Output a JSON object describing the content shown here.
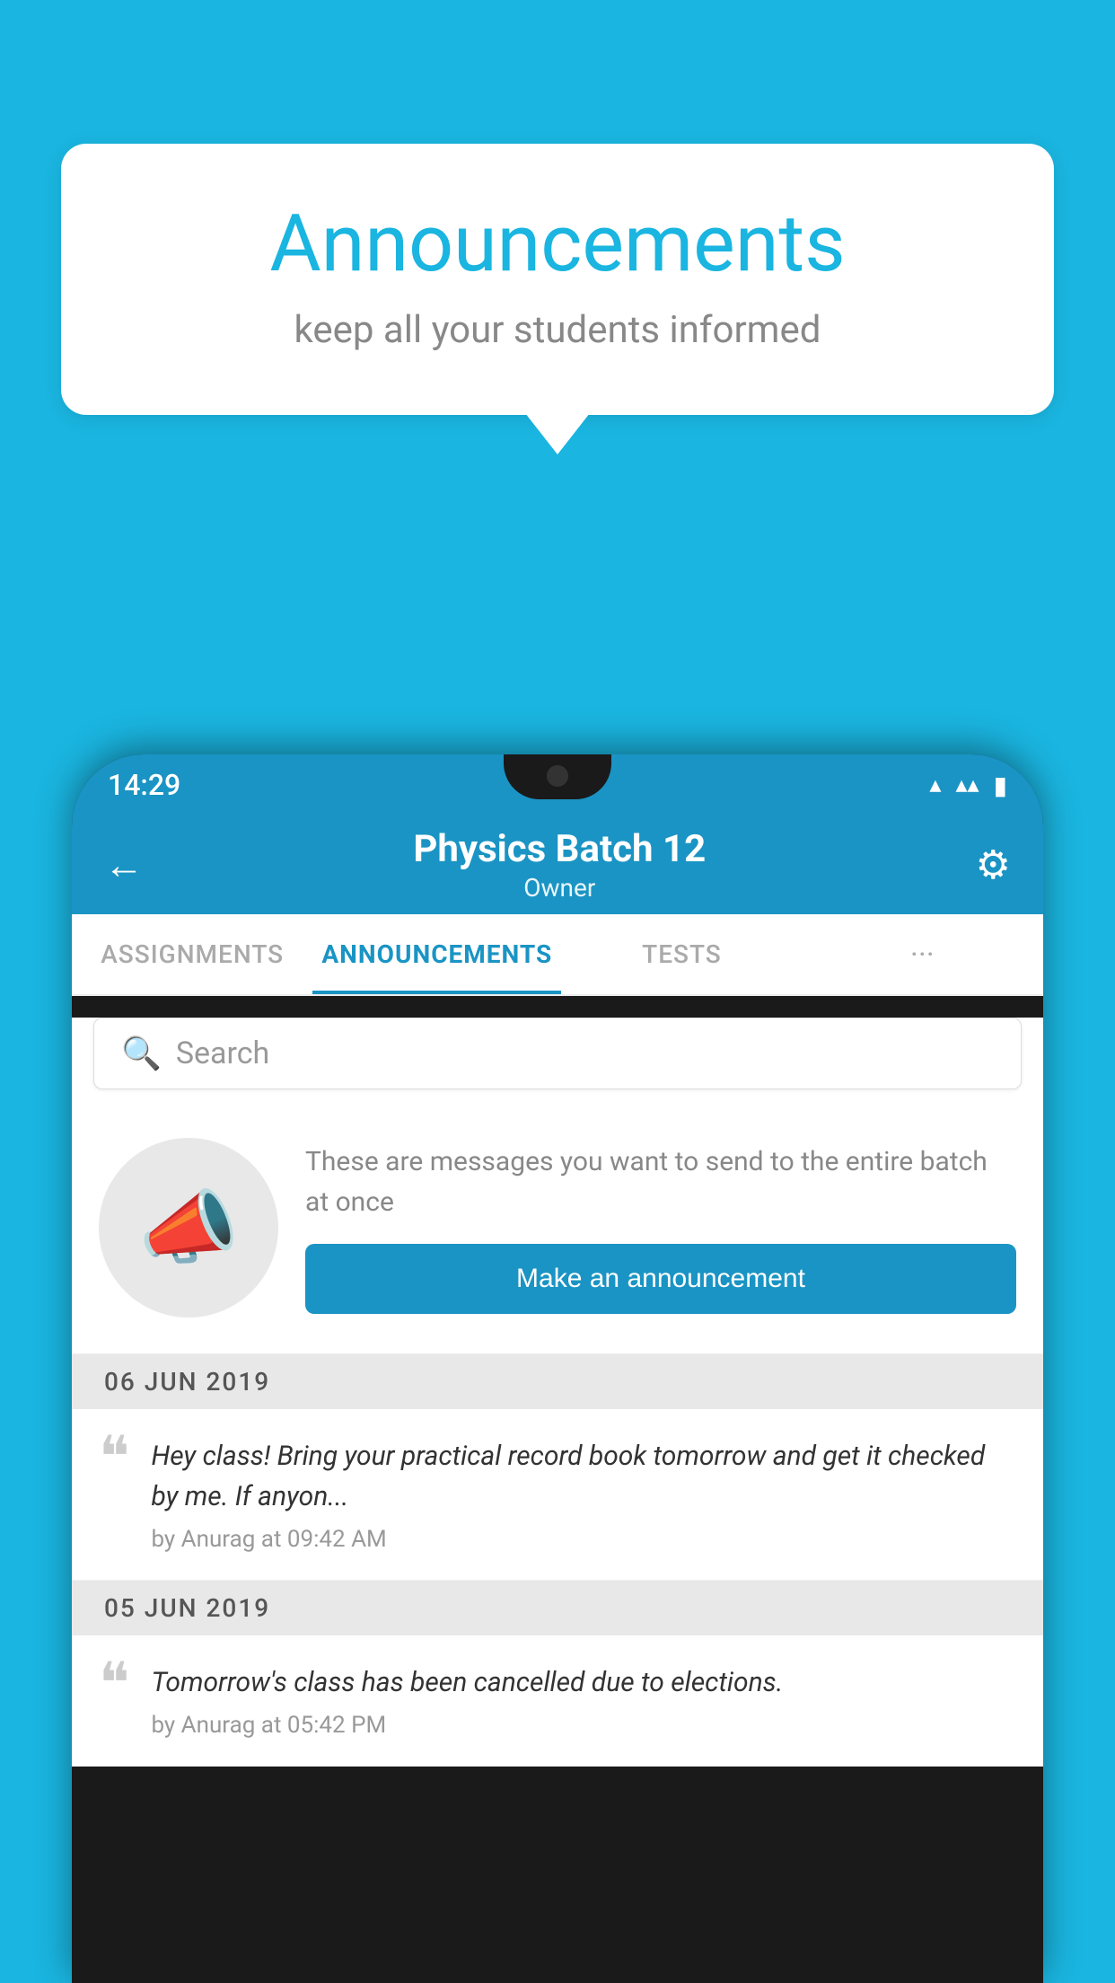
{
  "background_color": "#1ab5e0",
  "bubble": {
    "title": "Announcements",
    "subtitle": "keep all your students informed"
  },
  "status_bar": {
    "time": "14:29",
    "icons": [
      "wifi",
      "signal",
      "battery"
    ]
  },
  "header": {
    "title": "Physics Batch 12",
    "subtitle": "Owner",
    "back_label": "←",
    "settings_label": "⚙"
  },
  "tabs": [
    {
      "label": "ASSIGNMENTS",
      "active": false
    },
    {
      "label": "ANNOUNCEMENTS",
      "active": true
    },
    {
      "label": "TESTS",
      "active": false
    },
    {
      "label": "···",
      "active": false
    }
  ],
  "search": {
    "placeholder": "Search"
  },
  "promo": {
    "description": "These are messages you want to send to the entire batch at once",
    "button_label": "Make an announcement"
  },
  "announcements": [
    {
      "date": "06  JUN  2019",
      "text": "Hey class! Bring your practical record book tomorrow and get it checked by me. If anyon...",
      "meta": "by Anurag at 09:42 AM"
    },
    {
      "date": "05  JUN  2019",
      "text": "Tomorrow's class has been cancelled due to elections.",
      "meta": "by Anurag at 05:42 PM"
    }
  ]
}
